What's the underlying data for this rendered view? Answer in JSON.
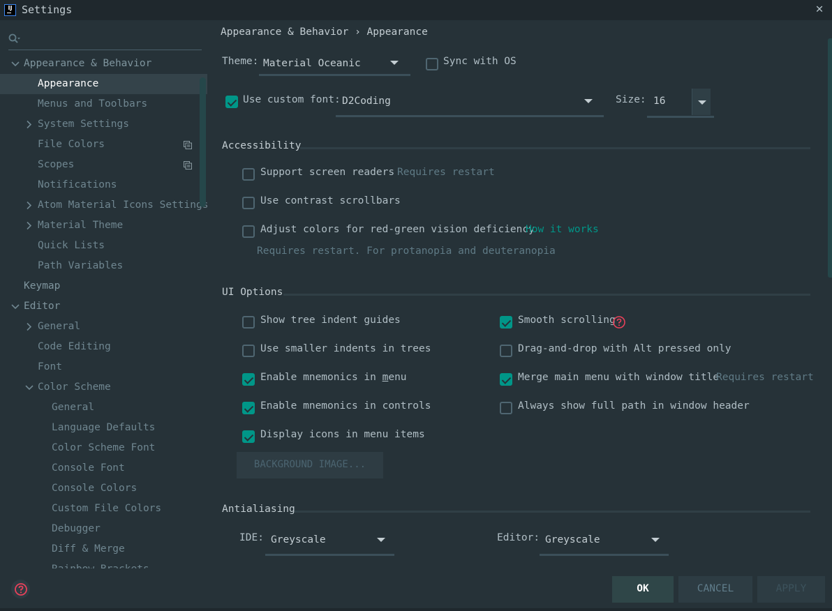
{
  "window": {
    "title": "Settings",
    "close_icon": "close-icon",
    "app_icon": "intellij-icon",
    "app_icon_text": "IJ"
  },
  "sidebar": {
    "search": {
      "placeholder": "",
      "value": "",
      "icon": "search-icon"
    },
    "items": [
      {
        "label": "Appearance & Behavior",
        "level": 0,
        "expander": "expanded",
        "style": "bold"
      },
      {
        "label": "Appearance",
        "level": 1,
        "expander": "none",
        "selected": true
      },
      {
        "label": "Menus and Toolbars",
        "level": 1,
        "expander": "none"
      },
      {
        "label": "System Settings",
        "level": 1,
        "expander": "collapsed"
      },
      {
        "label": "File Colors",
        "level": 1,
        "expander": "none",
        "badge_icon": "project-settings-icon"
      },
      {
        "label": "Scopes",
        "level": 1,
        "expander": "none",
        "badge_icon": "project-settings-icon"
      },
      {
        "label": "Notifications",
        "level": 1,
        "expander": "none"
      },
      {
        "label": "Atom Material Icons Settings",
        "level": 1,
        "expander": "collapsed"
      },
      {
        "label": "Material Theme",
        "level": 1,
        "expander": "collapsed"
      },
      {
        "label": "Quick Lists",
        "level": 1,
        "expander": "none"
      },
      {
        "label": "Path Variables",
        "level": 1,
        "expander": "none"
      },
      {
        "label": "Keymap",
        "level": 0,
        "expander": "none",
        "style": "bold"
      },
      {
        "label": "Editor",
        "level": 0,
        "expander": "expanded",
        "style": "bold"
      },
      {
        "label": "General",
        "level": 1,
        "expander": "collapsed"
      },
      {
        "label": "Code Editing",
        "level": 1,
        "expander": "none"
      },
      {
        "label": "Font",
        "level": 1,
        "expander": "none"
      },
      {
        "label": "Color Scheme",
        "level": 1,
        "expander": "expanded"
      },
      {
        "label": "General",
        "level": 2,
        "expander": "none"
      },
      {
        "label": "Language Defaults",
        "level": 2,
        "expander": "none"
      },
      {
        "label": "Color Scheme Font",
        "level": 2,
        "expander": "none"
      },
      {
        "label": "Console Font",
        "level": 2,
        "expander": "none"
      },
      {
        "label": "Console Colors",
        "level": 2,
        "expander": "none"
      },
      {
        "label": "Custom File Colors",
        "level": 2,
        "expander": "none"
      },
      {
        "label": "Debugger",
        "level": 2,
        "expander": "none"
      },
      {
        "label": "Diff & Merge",
        "level": 2,
        "expander": "none"
      },
      {
        "label": "Rainbow Brackets",
        "level": 2,
        "expander": "none"
      }
    ]
  },
  "breadcrumb": {
    "parent": "Appearance & Behavior",
    "separator": "›",
    "current": "Appearance"
  },
  "theme": {
    "label": "Theme:",
    "value": "Material Oceanic",
    "sync_label": "Sync with OS",
    "sync_checked": false
  },
  "custom_font": {
    "label": "Use custom font:",
    "checked": true,
    "value": "D2Coding",
    "size_label": "Size:",
    "size_value": "16"
  },
  "accessibility": {
    "title": "Accessibility",
    "options": [
      {
        "label": "Support screen readers",
        "checked": false,
        "note": "Requires restart"
      },
      {
        "label": "Use contrast scrollbars",
        "checked": false
      },
      {
        "label": "Adjust colors for red-green vision deficiency",
        "checked": false,
        "link": "How it works"
      }
    ],
    "hint": "Requires restart. For protanopia and deuteranopia"
  },
  "ui_options": {
    "title": "UI Options",
    "left": [
      {
        "label": "Show tree indent guides",
        "checked": false
      },
      {
        "label": "Use smaller indents in trees",
        "checked": false
      },
      {
        "label": "Enable mnemonics in menu",
        "checked": true,
        "mnemonic": "m"
      },
      {
        "label": "Enable mnemonics in controls",
        "checked": true
      },
      {
        "label": "Display icons in menu items",
        "checked": true
      }
    ],
    "right": [
      {
        "label": "Smooth scrolling",
        "checked": true,
        "help_icon": "help-icon"
      },
      {
        "label": "Drag-and-drop with Alt pressed only",
        "checked": false
      },
      {
        "label": "Merge main menu with window title",
        "checked": true,
        "note": "Requires restart"
      },
      {
        "label": "Always show full path in window header",
        "checked": false
      }
    ],
    "background_button": "BACKGROUND IMAGE..."
  },
  "antialiasing": {
    "title": "Antialiasing",
    "ide_label": "IDE:",
    "ide_value": "Greyscale",
    "editor_label": "Editor:",
    "editor_value": "Greyscale"
  },
  "footer": {
    "ok": "OK",
    "cancel": "CANCEL",
    "apply": "APPLY",
    "help_icon": "help-icon"
  },
  "colors": {
    "accent": "#009688",
    "background": "#263238",
    "titlebar": "#1f282d",
    "selection": "#34434a",
    "help": "#e8415a"
  }
}
